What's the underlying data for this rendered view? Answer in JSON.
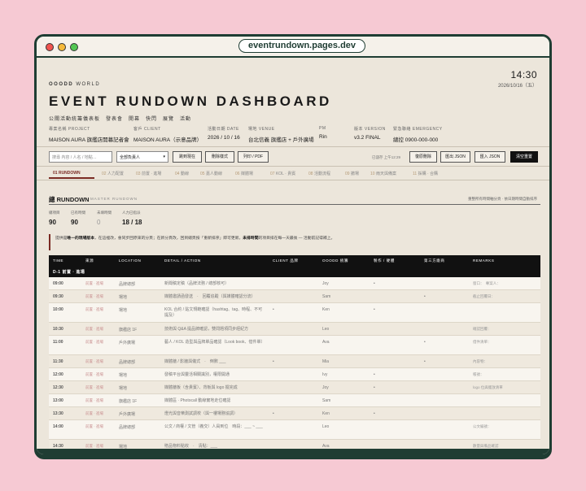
{
  "url": "eventrundown.pages.dev",
  "header": {
    "brand": "OOODD",
    "brand_sub": "WORLD",
    "clock": "14:30",
    "date": "2026/10/16（五）",
    "title": "EVENT RUNDOWN DASHBOARD",
    "subtitle": "公關活動統籌儀表板　發表會　開幕　快閃　展覽　活動"
  },
  "meta": [
    {
      "label": "專案名稱 PROJECT",
      "value": "MAISON AURA 旗艦店開幕記者會"
    },
    {
      "label": "客戶 CLIENT",
      "value": "MAISON AURA（示意品牌）"
    },
    {
      "label": "活動日期 DATE",
      "value": "2026 / 10 / 16"
    },
    {
      "label": "場地 VENUE",
      "value": "台北信義 旗艦店 + 戶外廣場"
    },
    {
      "label": "PM",
      "value": "Rin"
    },
    {
      "label": "版本 VERSION",
      "value": "v3.2 FINAL"
    },
    {
      "label": "緊急聯絡 EMERGENCY",
      "value": "總控 0900-000-000"
    }
  ],
  "toolbar": {
    "search_placeholder": "搜尋 內容 / 人名 / 地點…",
    "select_value": "全部負責人",
    "btn_now": "跳到現在",
    "btn_clear_style": "刪除樣式",
    "btn_print": "列印 / PDF",
    "saved": "已儲存 上午12:29",
    "btn_restore": "復原刪除",
    "btn_export": "匯出 JSON",
    "btn_import": "匯入 JSON",
    "btn_reset": "清空重置"
  },
  "tabs": [
    {
      "num": "01",
      "label": "RUNDOWN"
    },
    {
      "num": "02",
      "label": "人力配置"
    },
    {
      "num": "03",
      "label": "前置 · 進場"
    },
    {
      "num": "04",
      "label": "動線"
    },
    {
      "num": "05",
      "label": "嘉人動線"
    },
    {
      "num": "06",
      "label": "媒體場"
    },
    {
      "num": "07",
      "label": "KOL · 貴賓"
    },
    {
      "num": "08",
      "label": "活動流程"
    },
    {
      "num": "09",
      "label": "撤場"
    },
    {
      "num": "10",
      "label": "雨天與備案"
    },
    {
      "num": "11",
      "label": "採購 · 合購"
    }
  ],
  "section": {
    "title": "總 RUNDOWN",
    "sub": "MASTER RUNDOWN",
    "hint": "重整所有時間軸分頁 · 依日期時間自動排序"
  },
  "stats": [
    {
      "label": "總項目",
      "value": "90"
    },
    {
      "label": "已有時間",
      "value": "90"
    },
    {
      "label": "未填時間",
      "value": "0"
    },
    {
      "label": "人力已指派",
      "value": "18 / 18"
    }
  ],
  "notice": {
    "pre": "提供是",
    "bold1": "唯一的現場版本",
    "mid": "，在這裡改，會同步回原來的分頁；在新分頁改，回到總頁按「重新排序」即可更新。",
    "bold2": "未排時間",
    "post": "的項目排在每一天最後 — 活動前記得補上。"
  },
  "table": {
    "columns": [
      "TIME",
      "來源",
      "LOCATION",
      "DETAIL / ACTION",
      "CLIENT 品牌",
      "OOODD 統籌",
      "製作 / 硬體",
      "第三方廠商",
      "REMARKS"
    ],
    "group": "D-1  前置 · 進場",
    "rows": [
      {
        "time": "09:00",
        "src": "前置 · 進場",
        "loc": "品牌總部",
        "detail": "新聞稿定稿（品牌法務 / 總部核可）",
        "client": "",
        "ooodd": "Joy",
        "prod": "•",
        "third": "",
        "remark": "窗口：　專案人："
      },
      {
        "time": "09:30",
        "src": "前置 · 進場",
        "loc": "場地",
        "detail": "媒體邀請函發送　·　回覆追蹤（與媒體確認分流）",
        "client": "",
        "ooodd": "Sam",
        "prod": "",
        "third": "•",
        "remark": "截止回覆日："
      },
      {
        "time": "10:00",
        "src": "前置 · 進場",
        "loc": "場地",
        "detail": "KOL 合約 / 貼文規範確認（hashtag、tag、時程、不可提及）",
        "client": "•",
        "ooodd": "Ken",
        "prod": "•",
        "third": "",
        "remark": ""
      },
      {
        "time": "10:30",
        "src": "前置 · 進場",
        "loc": "旗艦店 1F",
        "detail": "技術與 Q&A 提品牌確認，雙問題項同步經紀方",
        "client": "",
        "ooodd": "Leo",
        "prod": "",
        "third": "",
        "remark": "確認回覆："
      },
      {
        "time": "11:00",
        "src": "前置 · 進場",
        "loc": "戶外廣場",
        "detail": "藝人 / KOL 造型與品牌單品確認（Look book、借件單）",
        "client": "",
        "ooodd": "Ava",
        "prod": "",
        "third": "•",
        "remark": "借件清單："
      },
      {
        "time": "11:30",
        "src": "前置 · 進場",
        "loc": "品牌總部",
        "detail": "媒體牆 / 影牆與儀式　·　倒數 ___",
        "client": "•",
        "ooodd": "Mia",
        "prod": "",
        "third": "•",
        "remark": "內容物："
      },
      {
        "time": "12:00",
        "src": "前置 · 進場",
        "loc": "場地",
        "detail": "發稿平台與靈活相關識別，權限開通",
        "client": "",
        "ooodd": "Ivy",
        "prod": "•",
        "third": "",
        "remark": "帳號："
      },
      {
        "time": "12:30",
        "src": "前置 · 進場",
        "loc": "場地",
        "detail": "媒體牆板（含貴賓）、背板與 logo 擺完成",
        "client": "",
        "ooodd": "Joy",
        "prod": "•",
        "third": "",
        "remark": "logo 位與擺放清單"
      },
      {
        "time": "13:00",
        "src": "前置 · 進場",
        "loc": "旗艦店 1F",
        "detail": "媒體區 · Photocall 動線實地走位確認",
        "client": "",
        "ooodd": "Sam",
        "prod": "",
        "third": "",
        "remark": ""
      },
      {
        "time": "13:30",
        "src": "前置 · 進場",
        "loc": "戶外廣場",
        "detail": "燈光與音樂測試調校（與一樓場務協調）",
        "client": "•",
        "ooodd": "Ken",
        "prod": "•",
        "third": "",
        "remark": ""
      },
      {
        "time": "14:00",
        "src": "前置 · 進場",
        "loc": "品牌總部",
        "detail": "公文 / 商權 / 文管（義交）人員到位　時段：___ ~ ___",
        "client": "",
        "ooodd": "Leo",
        "prod": "",
        "third": "",
        "remark": "公文編號："
      },
      {
        "time": "14:30",
        "src": "前置 · 進場",
        "loc": "場地",
        "detail": "贈品物料點收　·　清點：___",
        "client": "",
        "ooodd": "Ava",
        "prod": "",
        "third": "",
        "remark": "數量與備品確認"
      }
    ]
  }
}
